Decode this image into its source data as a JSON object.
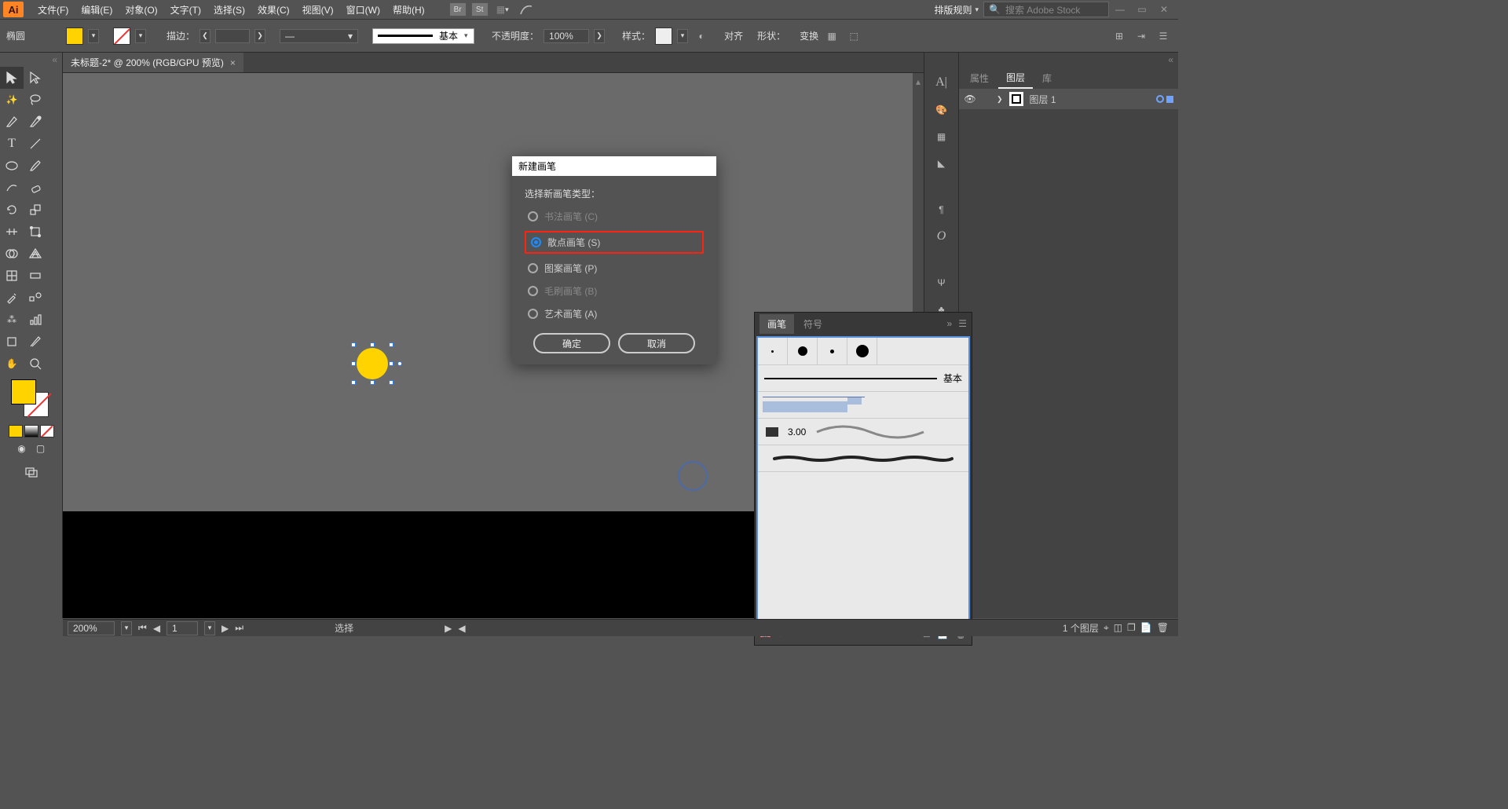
{
  "app": {
    "logo": "Ai"
  },
  "menu": [
    "文件(F)",
    "编辑(E)",
    "对象(O)",
    "文字(T)",
    "选择(S)",
    "效果(C)",
    "视图(V)",
    "窗口(W)",
    "帮助(H)"
  ],
  "menubar_right": {
    "layout_rule": "排版规则",
    "search_placeholder": "搜索 Adobe Stock"
  },
  "control": {
    "shape": "椭圆",
    "stroke_label": "描边：",
    "style_basic": "基本",
    "opacity_label": "不透明度：",
    "opacity_value": "100%",
    "style_label": "样式：",
    "align": "对齐",
    "shape_menu": "形状：",
    "transform": "变换"
  },
  "doc_tab": {
    "title": "未标题-2* @ 200% (RGB/GPU 预览)"
  },
  "dialog": {
    "title": "新建画笔",
    "label": "选择新画笔类型：",
    "options": {
      "calligraphic": "书法画笔 (C)",
      "scatter": "散点画笔 (S)",
      "pattern": "图案画笔 (P)",
      "bristle": "毛刷画笔 (B)",
      "art": "艺术画笔 (A)"
    },
    "ok": "确定",
    "cancel": "取消"
  },
  "brushes_panel": {
    "tab_brush": "画笔",
    "tab_symbol": "符号",
    "basic": "基本",
    "size": "3.00"
  },
  "layers_panel": {
    "tab_properties": "属性",
    "tab_layers": "图层",
    "tab_library": "库",
    "layer_name": "图层 1"
  },
  "status": {
    "zoom": "200%",
    "page": "1",
    "mode": "选择",
    "layer_count": "1 个图层"
  }
}
